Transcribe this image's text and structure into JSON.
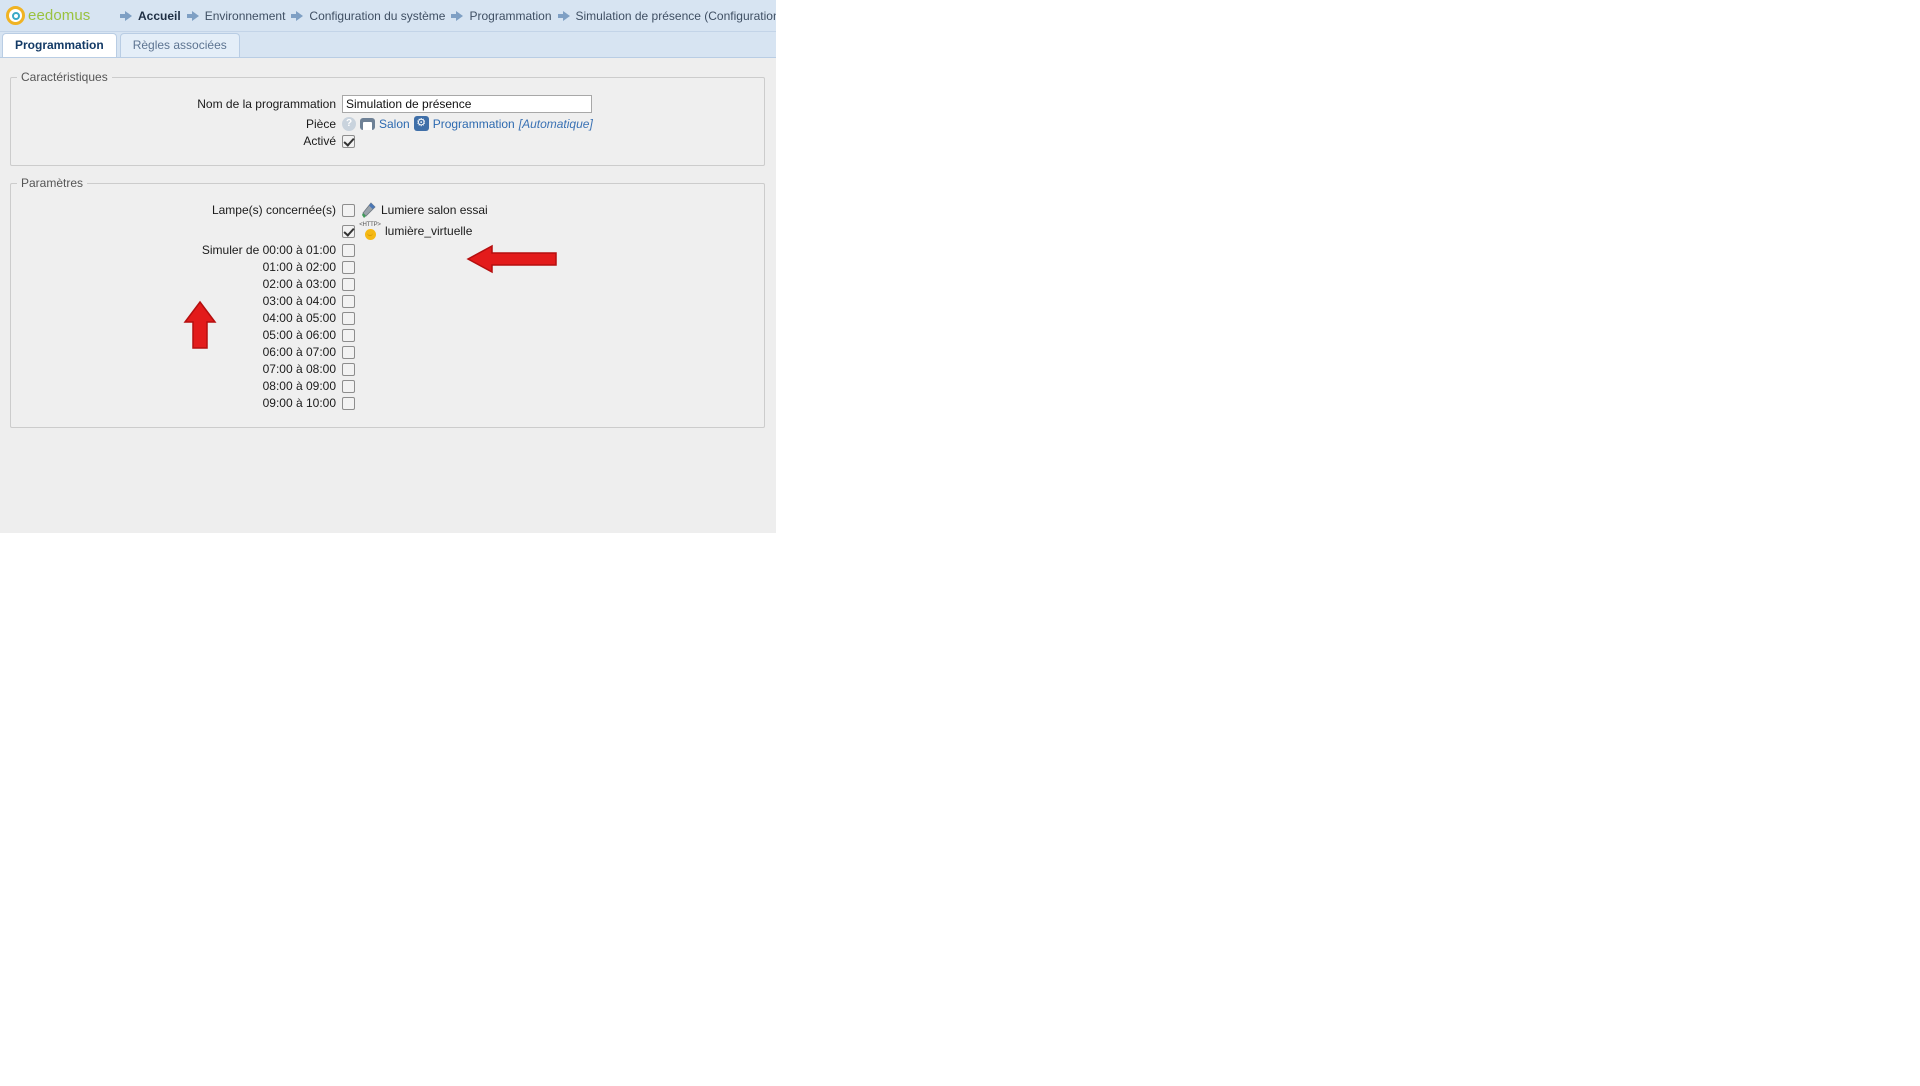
{
  "brand": {
    "name": "eedomus",
    "logo_icon": "eedomus-circle-logo"
  },
  "breadcrumb": [
    {
      "label": "Accueil",
      "icon": "arrow-right-icon",
      "current": true
    },
    {
      "label": "Environnement",
      "icon": "arrow-right-icon"
    },
    {
      "label": "Configuration du système",
      "icon": "arrow-right-icon"
    },
    {
      "label": "Programmation",
      "icon": "arrow-right-icon"
    },
    {
      "label": "Simulation de présence (Configuration)",
      "icon": "arrow-right-icon"
    }
  ],
  "tabs": [
    {
      "label": "Programmation",
      "active": true
    },
    {
      "label": "Règles associées",
      "active": false
    }
  ],
  "caracteristiques": {
    "legend": "Caractéristiques",
    "name_label": "Nom de la programmation",
    "name_value": "Simulation de présence",
    "name_placeholder": "",
    "piece_label": "Pièce",
    "help_glyph": "?",
    "piece_room": "Salon",
    "piece_category": "Programmation",
    "piece_auto": "[Automatique]",
    "active_label": "Activé",
    "active_checked": true
  },
  "parametres": {
    "legend": "Paramètres",
    "lamps_label": "Lampe(s) concernée(s)",
    "lamps": [
      {
        "name": "Lumiere salon essai",
        "checked": false,
        "icon": "lamp-icon"
      },
      {
        "name": "lumière_virtuelle",
        "checked": true,
        "icon": "http-bulb-icon",
        "tag": "<HTTP>"
      }
    ],
    "simulate_label": "Simuler de",
    "slots": [
      {
        "label": "00:00 à 01:00",
        "checked": false,
        "first": true
      },
      {
        "label": "01:00 à 02:00",
        "checked": false
      },
      {
        "label": "02:00 à 03:00",
        "checked": false
      },
      {
        "label": "03:00 à 04:00",
        "checked": false
      },
      {
        "label": "04:00 à 05:00",
        "checked": false
      },
      {
        "label": "05:00 à 06:00",
        "checked": false
      },
      {
        "label": "06:00 à 07:00",
        "checked": false
      },
      {
        "label": "07:00 à 08:00",
        "checked": false
      },
      {
        "label": "08:00 à 09:00",
        "checked": false
      },
      {
        "label": "09:00 à 10:00",
        "checked": false
      }
    ]
  },
  "annotations": {
    "color": "#e31b1b",
    "arrow_left": {
      "target": "lumière_virtuelle row"
    },
    "arrow_up": {
      "target": "Simuler de 00:00 à 01:00 row"
    }
  }
}
